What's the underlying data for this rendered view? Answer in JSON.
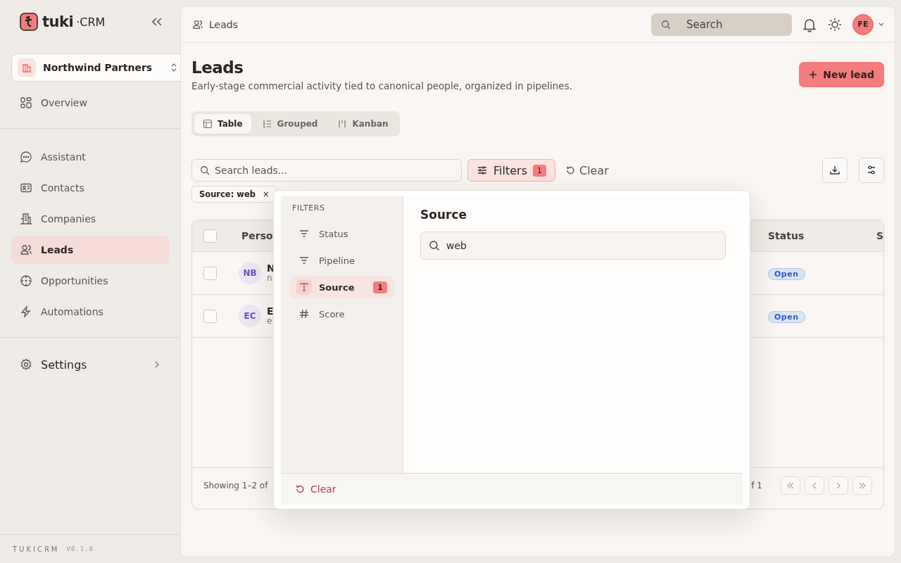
{
  "brand": {
    "name": "tuki",
    "separator": "·",
    "suffix": "CRM"
  },
  "workspace": {
    "name": "Northwind Partners"
  },
  "nav_top": [
    {
      "label": "Overview",
      "selected": false
    }
  ],
  "nav": [
    {
      "label": "Assistant",
      "selected": false
    },
    {
      "label": "Contacts",
      "selected": false
    },
    {
      "label": "Companies",
      "selected": false
    },
    {
      "label": "Leads",
      "selected": true
    },
    {
      "label": "Opportunities",
      "selected": false
    },
    {
      "label": "Automations",
      "selected": false
    }
  ],
  "settings": {
    "label": "Settings"
  },
  "footer": {
    "name": "TUKICRM",
    "version": "V0.1.0"
  },
  "header": {
    "breadcrumb": "Leads",
    "search_placeholder": "Search",
    "avatar": "FE"
  },
  "page": {
    "title": "Leads",
    "subtitle": "Early-stage commercial activity tied to canonical people, organized in pipelines.",
    "new_button": "New lead"
  },
  "view_tabs": [
    {
      "label": "Table",
      "selected": true
    },
    {
      "label": "Grouped",
      "selected": false
    },
    {
      "label": "Kanban",
      "selected": false
    }
  ],
  "toolbar": {
    "search_placeholder": "Search leads...",
    "filters_label": "Filters",
    "filters_count": "1",
    "clear_label": "Clear"
  },
  "active_filters": [
    {
      "label": "Source: web",
      "remove": "×"
    }
  ],
  "table": {
    "select_all_checked": false,
    "columns": [
      "Perso",
      "Status",
      "S"
    ],
    "rows": [
      {
        "checked": false,
        "initials": "NB",
        "name": "N",
        "sub": "n",
        "status": "Open"
      },
      {
        "checked": false,
        "initials": "EC",
        "name": "E",
        "sub": "e",
        "status": "Open"
      }
    ],
    "showing": "Showing 1–2 of",
    "page_of": "f 1"
  },
  "filter_popover": {
    "heading": "FILTERS",
    "items": [
      {
        "label": "Status",
        "selected": false
      },
      {
        "label": "Pipeline",
        "selected": false
      },
      {
        "label": "Source",
        "selected": true,
        "count": "1"
      },
      {
        "label": "Score",
        "selected": false
      }
    ],
    "panel_title": "Source",
    "value": "web",
    "clear_label": "Clear"
  }
}
